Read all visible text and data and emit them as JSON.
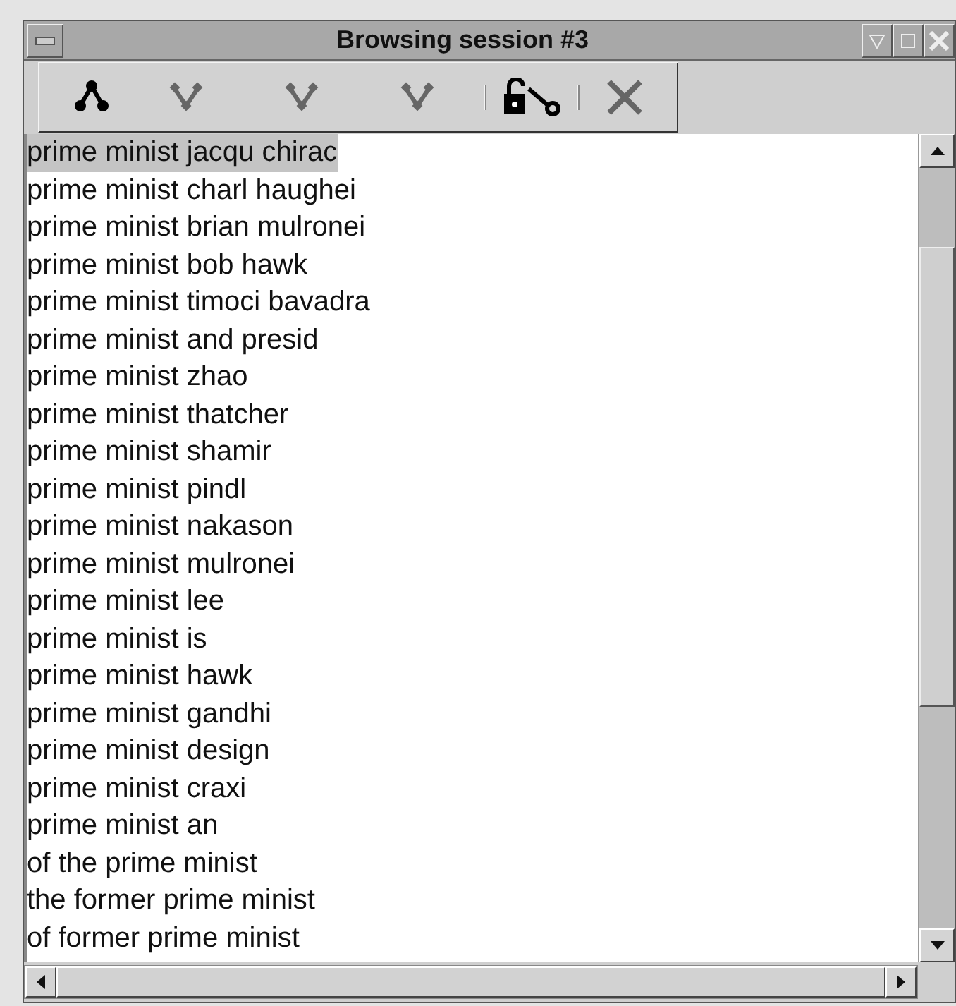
{
  "window": {
    "title": "Browsing session #3"
  },
  "toolbar": [
    {
      "kind": "parent",
      "disabled": false
    },
    {
      "kind": "branch",
      "disabled": true
    },
    {
      "kind": "branch",
      "disabled": true
    },
    {
      "kind": "branch",
      "disabled": true
    },
    {
      "kind": "separator"
    },
    {
      "kind": "unlock",
      "disabled": false
    },
    {
      "kind": "separator"
    },
    {
      "kind": "close",
      "disabled": true
    }
  ],
  "list": [
    {
      "text": "prime minist jacqu chirac",
      "selected": true
    },
    {
      "text": "prime minist charl haughei",
      "selected": false
    },
    {
      "text": "prime minist brian mulronei",
      "selected": false
    },
    {
      "text": "prime minist bob hawk",
      "selected": false
    },
    {
      "text": "prime minist timoci bavadra",
      "selected": false
    },
    {
      "text": "prime minist and presid",
      "selected": false
    },
    {
      "text": "prime minist zhao",
      "selected": false
    },
    {
      "text": "prime minist thatcher",
      "selected": false
    },
    {
      "text": "prime minist shamir",
      "selected": false
    },
    {
      "text": "prime minist pindl",
      "selected": false
    },
    {
      "text": "prime minist nakason",
      "selected": false
    },
    {
      "text": "prime minist mulronei",
      "selected": false
    },
    {
      "text": "prime minist lee",
      "selected": false
    },
    {
      "text": "prime minist is",
      "selected": false
    },
    {
      "text": "prime minist hawk",
      "selected": false
    },
    {
      "text": "prime minist gandhi",
      "selected": false
    },
    {
      "text": "prime minist design",
      "selected": false
    },
    {
      "text": "prime minist craxi",
      "selected": false
    },
    {
      "text": "prime minist an",
      "selected": false
    },
    {
      "text": "of the prime minist",
      "selected": false
    },
    {
      "text": "the former prime minist",
      "selected": false
    },
    {
      "text": "of former prime minist",
      "selected": false
    }
  ]
}
